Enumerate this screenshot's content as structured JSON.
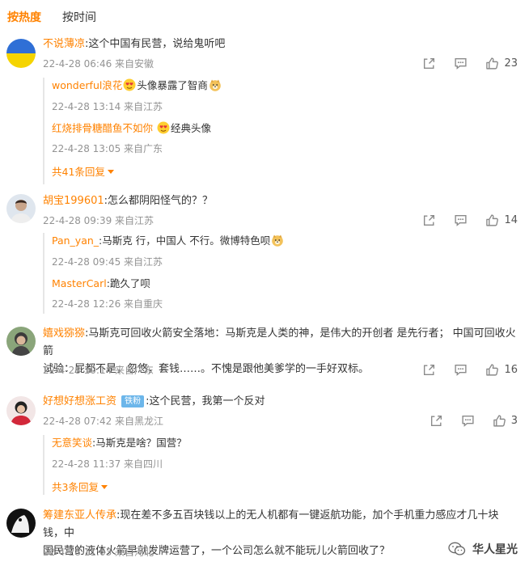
{
  "tabs": {
    "hot": "按热度",
    "time": "按时间"
  },
  "comments": [
    {
      "user": "不说薄凉",
      "text": ":这个中国有民营，说给鬼听吧",
      "meta": "22-4-28 06:46 来自安徽",
      "likes": "23",
      "replies": [
        {
          "user": "wonderful浪花",
          "text": "头像暴露了智商",
          "meta": "22-4-28 13:14 来自江苏"
        },
        {
          "user": "红烧排骨糖醋鱼不如你",
          "text": "经典头像",
          "meta": "22-4-28 13:05 来自广东"
        }
      ],
      "more": "共41条回复"
    },
    {
      "user": "胡宝199601",
      "text": ":怎么都阴阳怪气的？？",
      "meta": "22-4-28 09:39 来自江苏",
      "likes": "14",
      "replies": [
        {
          "user": "Pan_yan_",
          "text": ":马斯克 行，中国人 不行。微博特色呗",
          "meta": "22-4-28 09:45 来自江苏"
        },
        {
          "user": "MasterCarl",
          "text": ":跪久了呗",
          "meta": "22-4-28 12:26 来自重庆"
        }
      ]
    },
    {
      "user": "嬉戏猕猕",
      "text_line1": ":马斯克可回收火箭安全落地：马斯克是人类的神，是伟大的开创者 是先行者； 中国可回收火箭",
      "text_line2": "试验：屁都不是，忽悠，套钱……。不愧是跟他美爹学的一手好双标。",
      "meta": "22-4-28 10:14 来自广东",
      "likes": "16"
    },
    {
      "user": "好想好想涨工资",
      "badge": "铁粉",
      "text": ":这个民营，我第一个反对",
      "meta": "22-4-28 07:42 来自黑龙江",
      "likes": "3",
      "replies": [
        {
          "user": "无意笑谈",
          "text": ":马斯克是啥？国营？",
          "meta": "22-4-28 11:37 来自四川"
        }
      ],
      "more": "共3条回复"
    },
    {
      "user": "筹建东亚人传承",
      "text_line1": ":现在差不多五百块钱以上的无人机都有一键返航功能，加个手机重力感应才几十块钱，中",
      "text_line2": "国民营的液体火箭早就发牌运营了，一个公司怎么就不能玩儿火箭回收了？",
      "meta": "22-4-28 11:03 来自河北"
    }
  ],
  "watermark": "华人星光",
  "colors": {
    "accent": "#ff8200",
    "meta": "#939393",
    "badge": "#6cb6ea"
  }
}
